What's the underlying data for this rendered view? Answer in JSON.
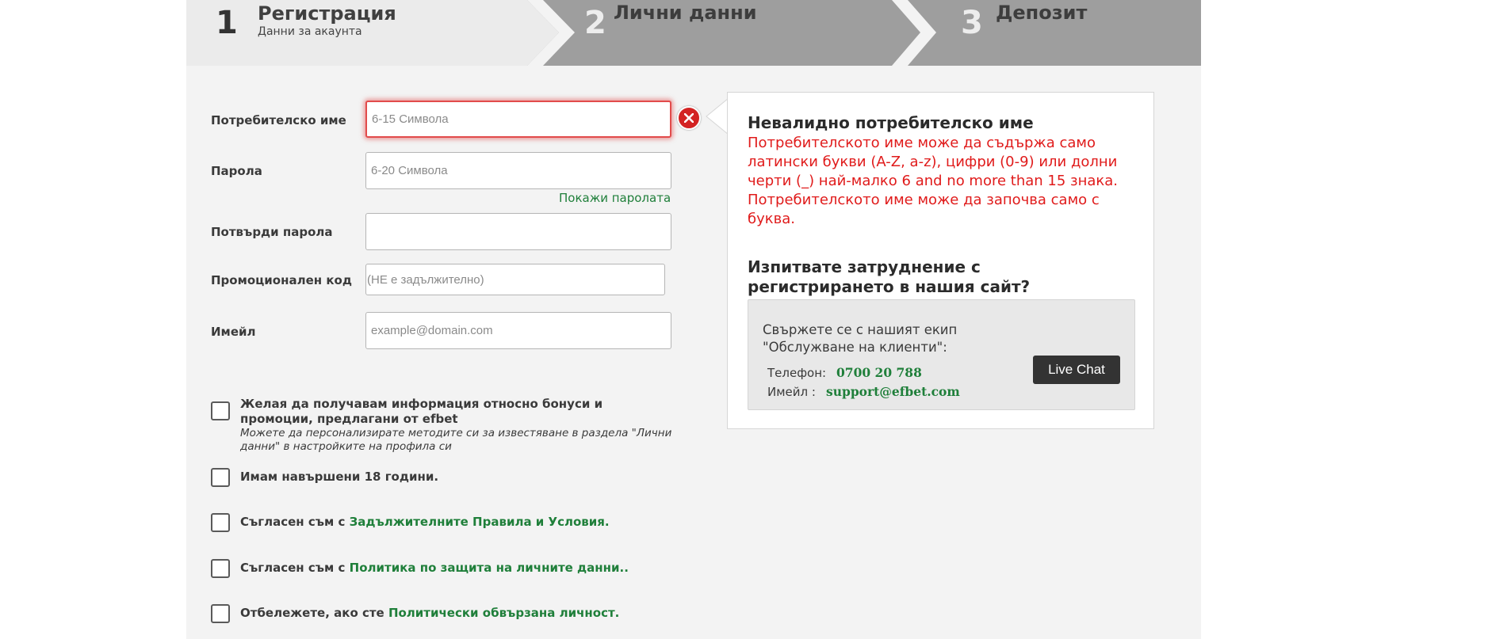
{
  "steps": [
    {
      "number": "1",
      "title": "Регистрация",
      "subtitle": "Данни за акаунта"
    },
    {
      "number": "2",
      "title": "Лични данни"
    },
    {
      "number": "3",
      "title": "Депозит"
    }
  ],
  "form": {
    "username": {
      "label": "Потребителско име",
      "placeholder": "6-15 Символа"
    },
    "password": {
      "label": "Парола",
      "placeholder": "6-20 Символа"
    },
    "show_password": "Покажи паролата",
    "confirm_password": {
      "label": "Потвърди парола",
      "placeholder": ""
    },
    "promo": {
      "label": "Промоционален код",
      "placeholder": "(НЕ е задължително)"
    },
    "email": {
      "label": "Имейл",
      "placeholder": "example@domain.com"
    }
  },
  "checkboxes": {
    "bonus": {
      "text": "Желая да получавам информация относно бонуси и промоции, предлагани от efbet",
      "note": "Можете да персонализирате методите си за известяване в раздела \"Лични данни\" в настройките на профила си"
    },
    "age": {
      "text": "Имам навършени 18 години."
    },
    "terms": {
      "prefix": "Съгласен съм с ",
      "link": "Задължителните Правила и Условия."
    },
    "privacy": {
      "prefix": "Съгласен съм с ",
      "link": "Политика по защита на личните данни.."
    },
    "pep": {
      "prefix": "Отбележете, ако сте ",
      "link": "Политически обвързана личност."
    }
  },
  "info": {
    "error_title": "Невалидно потребителско име",
    "error_text": "Потребителското име може да съдържа само латински букви (A-Z, a-z), цифри (0-9) или долни черти (_) най-малко 6 and no more than 15 знака. Потребителското име може да започва само с буква.",
    "help_title": "Изпитвате затруднение с регистрирането в нашия сайт?",
    "help_intro": "Свържете се с нашият екип \"Обслужване на клиенти\":",
    "phone_label": "Телефон:",
    "phone_value": "0700 20 788",
    "email_label": "Имейл :",
    "email_value": "support@efbet.com",
    "live_chat": "Live Chat"
  },
  "colors": {
    "accent_green": "#1f7f3a",
    "error_red": "#e01b1b",
    "step_inactive": "#9e9e9e",
    "panel_bg": "#f3f3f3"
  },
  "icons": {
    "error_badge": "close-x-circle-icon",
    "info_pointer": "arrow-left-icon"
  }
}
